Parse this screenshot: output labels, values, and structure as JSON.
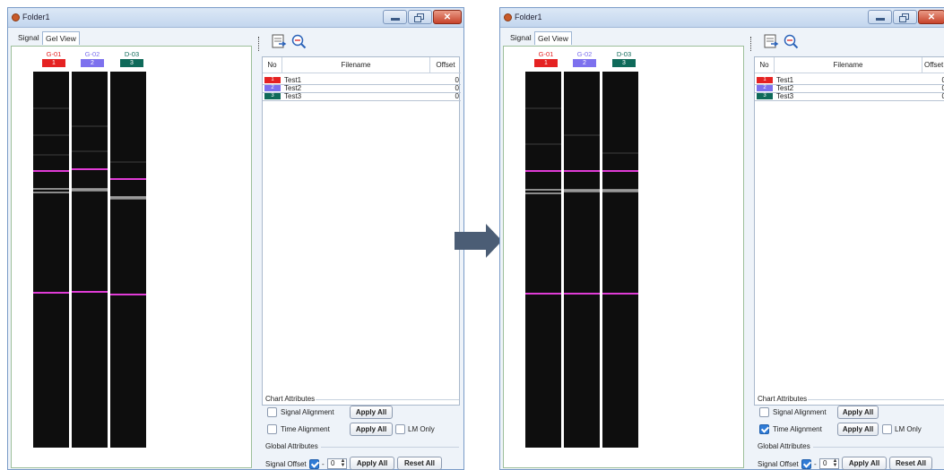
{
  "colors": {
    "red": "#e52222",
    "blue": "#7d71ee",
    "teal": "#0f6a5a",
    "magenta": "#e03cd6"
  },
  "arrow": {
    "icon": "right-arrow-icon"
  },
  "windows": [
    {
      "title": "Folder1",
      "tabs": [
        "Signal",
        "Gel View"
      ],
      "lanes": [
        {
          "label": "G-01",
          "num": "1"
        },
        {
          "label": "G-02",
          "num": "2"
        },
        {
          "label": "D-03",
          "num": "3"
        }
      ],
      "table": {
        "headers": [
          "No",
          "Filename",
          "Offset"
        ],
        "rows": [
          {
            "badge": "1",
            "name": "Test1",
            "offset": "0"
          },
          {
            "badge": "2",
            "name": "Test2",
            "offset": "0"
          },
          {
            "badge": "3",
            "name": "Test3",
            "offset": "0"
          }
        ]
      },
      "chart_attributes": {
        "title": "Chart Attributes",
        "signal_alignment": {
          "label": "Signal Alignment",
          "checked": false,
          "button": "Apply All"
        },
        "time_alignment": {
          "label": "Time Alignment",
          "checked": false,
          "button": "Apply All"
        },
        "lm_only": {
          "label": "LM Only",
          "checked": false
        }
      },
      "global_attributes": {
        "title": "Global Attributes",
        "signal_offset_label": "Signal Offset",
        "signal_offset_checked": true,
        "dash": "-",
        "offset_value": "0",
        "apply_all": "Apply All",
        "reset_all": "Reset All"
      }
    },
    {
      "title": "Folder1",
      "tabs": [
        "Signal",
        "Gel View"
      ],
      "lanes": [
        {
          "label": "G-01",
          "num": "1"
        },
        {
          "label": "G-02",
          "num": "2"
        },
        {
          "label": "D-03",
          "num": "3"
        }
      ],
      "table": {
        "headers": [
          "No",
          "Filename",
          "Offset"
        ],
        "rows": [
          {
            "badge": "1",
            "name": "Test1",
            "offset": "0"
          },
          {
            "badge": "2",
            "name": "Test2",
            "offset": "0"
          },
          {
            "badge": "3",
            "name": "Test3",
            "offset": "0"
          }
        ]
      },
      "chart_attributes": {
        "title": "Chart Attributes",
        "signal_alignment": {
          "label": "Signal Alignment",
          "checked": false,
          "button": "Apply All"
        },
        "time_alignment": {
          "label": "Time Alignment",
          "checked": true,
          "button": "Apply All"
        },
        "lm_only": {
          "label": "LM Only",
          "checked": false
        }
      },
      "global_attributes": {
        "title": "Global Attributes",
        "signal_offset_label": "Signal Offset",
        "signal_offset_checked": true,
        "dash": "-",
        "offset_value": "0",
        "apply_all": "Apply All",
        "reset_all": "Reset All"
      }
    }
  ]
}
